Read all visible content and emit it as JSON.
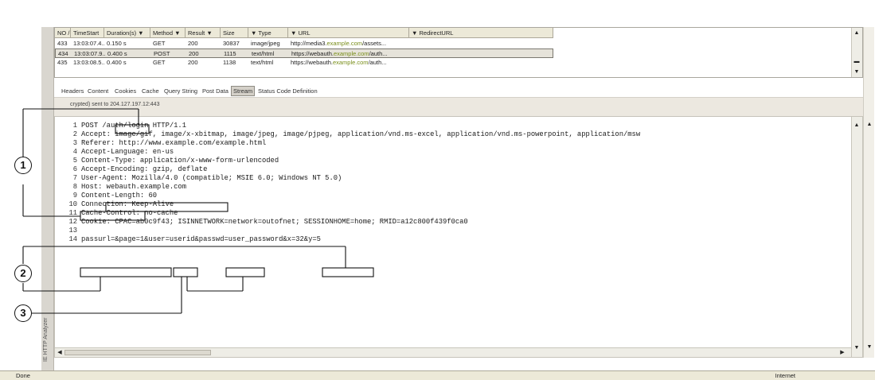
{
  "grid": {
    "columns": [
      "NO /",
      "TimeStart",
      "Duration(s) ▼",
      "Method ▼",
      "Result ▼",
      "Size",
      "▼ Type",
      "▼ URL",
      "▼ RedirectURL"
    ],
    "rows": [
      {
        "no": "433",
        "time": "13:03:07.4...",
        "duration": "0.150 s",
        "method": "GET",
        "result": "200",
        "size": "30837",
        "type": "image/jpeg",
        "url_prefix": "http://media3.",
        "url_host": "example.com",
        "url_suffix": "/assets...",
        "selected": false
      },
      {
        "no": "434",
        "time": "13:03:07.9...",
        "duration": "0.400 s",
        "method": "POST",
        "result": "200",
        "size": "1115",
        "type": "text/html",
        "url_prefix": "https://webauth.",
        "url_host": "example.com",
        "url_suffix": "/auth...",
        "selected": true
      },
      {
        "no": "435",
        "time": "13:03:08.5...",
        "duration": "0.400 s",
        "method": "GET",
        "result": "200",
        "size": "1138",
        "type": "text/html",
        "url_prefix": "https://webauth.",
        "url_host": "example.com",
        "url_suffix": "/auth...",
        "selected": false
      }
    ]
  },
  "tabs": [
    "Headers",
    "Content",
    "Cookies",
    "Cache",
    "Query String",
    "Post Data",
    "Stream",
    "Status Code Definition"
  ],
  "active_tab": "Stream",
  "info_text": "crypted) sent to 204.127.197.12:443",
  "stream_lines": [
    {
      "n": "1",
      "text": "POST /auth/login HTTP/1.1"
    },
    {
      "n": "2",
      "text": "Accept: image/gif, image/x-xbitmap, image/jpeg, image/pjpeg, application/vnd.ms-excel, application/vnd.ms-powerpoint, application/msw"
    },
    {
      "n": "3",
      "text": "Referer: http://www.example.com/example.html"
    },
    {
      "n": "4",
      "text": "Accept-Language: en-us"
    },
    {
      "n": "5",
      "text": "Content-Type: application/x-www-form-urlencoded"
    },
    {
      "n": "6",
      "text": "Accept-Encoding: gzip, deflate"
    },
    {
      "n": "7",
      "text": "User-Agent: Mozilla/4.0 (compatible; MSIE 6.0; Windows NT 5.0)"
    },
    {
      "n": "8",
      "text": "Host: webauth.example.com"
    },
    {
      "n": "9",
      "text": "Content-Length: 60"
    },
    {
      "n": "10",
      "text": "Connection: Keep-Alive"
    },
    {
      "n": "11",
      "text": "Cache-Control: no-cache"
    },
    {
      "n": "12",
      "text": "Cookie: CPAC=ab0c9f43; ISINNETWORK=network=outofnet; SESSIONHOME=home; RMID=a12c800f439f0ca0"
    },
    {
      "n": "13",
      "text": ""
    },
    {
      "n": "14",
      "text": "passurl=&page=1&user=userid&passwd=user_password&x=32&y=5"
    }
  ],
  "side_title": "IE HTTP Analyzer",
  "status": {
    "left": "Done",
    "zone": "Internet"
  },
  "callouts": [
    "1",
    "2",
    "3"
  ]
}
